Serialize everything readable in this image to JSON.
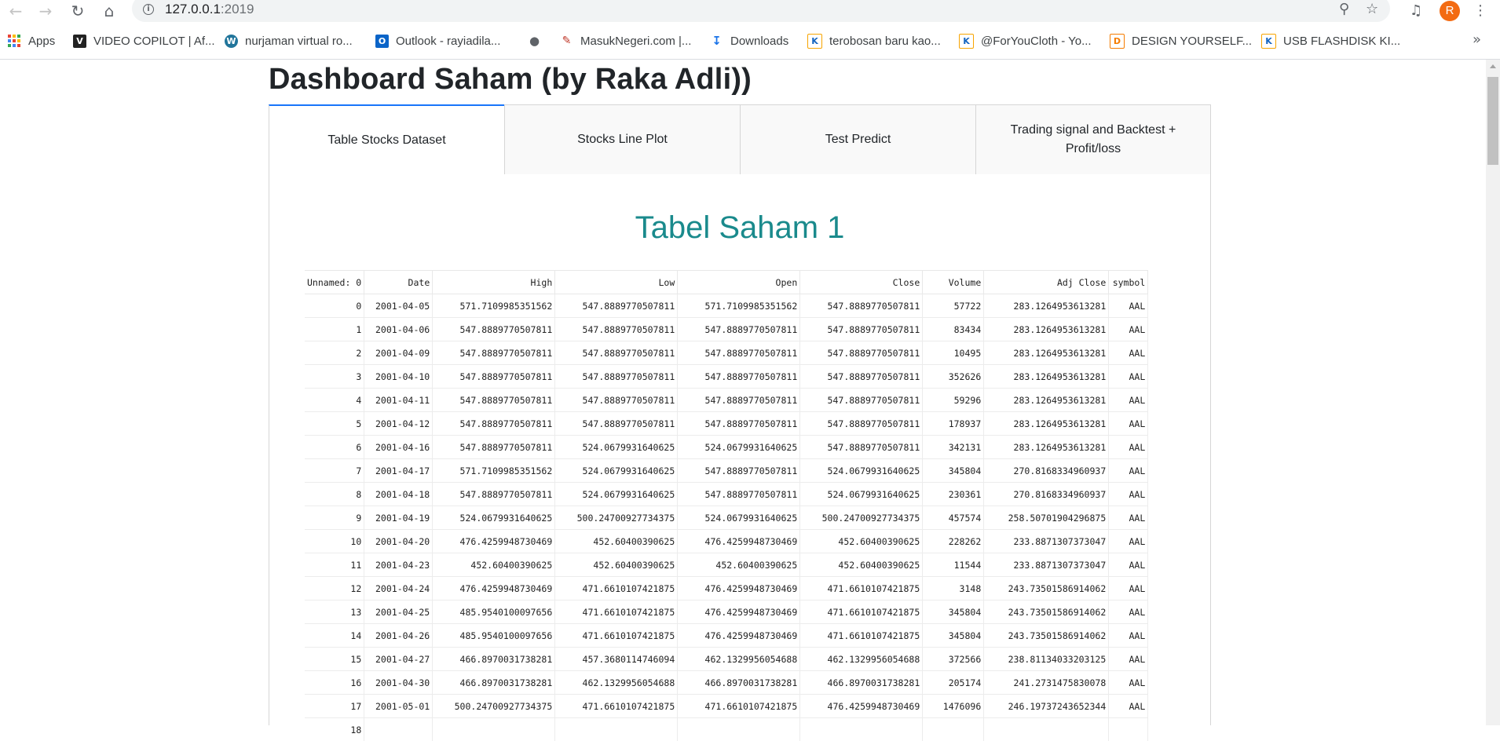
{
  "browser": {
    "url_host": "127.0.0.1",
    "url_port": ":2019",
    "avatar_letter": "R"
  },
  "bookmarks": [
    {
      "label": "Apps",
      "icon": "apps-grid-icon"
    },
    {
      "label": "VIDEO COPILOT | Af...",
      "icon": "videocopilot-icon"
    },
    {
      "label": "nurjaman virtual ro...",
      "icon": "wordpress-icon"
    },
    {
      "label": "Outlook - rayiadila...",
      "icon": "outlook-icon"
    },
    {
      "label": "",
      "icon": "globe-icon"
    },
    {
      "label": "MasukNegeri.com |...",
      "icon": "masuknegeri-icon"
    },
    {
      "label": "Downloads",
      "icon": "download-icon"
    },
    {
      "label": "terobosan baru kao...",
      "icon": "kaskus-icon"
    },
    {
      "label": "@ForYouCloth - Yo...",
      "icon": "kaskus-icon"
    },
    {
      "label": "DESIGN YOURSELF...",
      "icon": "design-icon"
    },
    {
      "label": "USB FLASHDISK KI...",
      "icon": "kaskus-icon"
    }
  ],
  "page": {
    "title": "Dashboard Saham (by Raka Adli))",
    "tabs": [
      {
        "label": "Table Stocks Dataset",
        "active": true
      },
      {
        "label": "Stocks Line Plot",
        "active": false
      },
      {
        "label": "Test Predict",
        "active": false
      },
      {
        "label": "Trading signal and Backtest + Profit/loss",
        "active": false
      }
    ],
    "section_title": "Tabel Saham 1"
  },
  "table": {
    "columns": [
      "Unnamed: 0",
      "Date",
      "High",
      "Low",
      "Open",
      "Close",
      "Volume",
      "Adj Close",
      "symbol"
    ],
    "rows": [
      [
        "0",
        "2001-04-05",
        "571.7109985351562",
        "547.8889770507811",
        "571.7109985351562",
        "547.8889770507811",
        "57722",
        "283.1264953613281",
        "AAL"
      ],
      [
        "1",
        "2001-04-06",
        "547.8889770507811",
        "547.8889770507811",
        "547.8889770507811",
        "547.8889770507811",
        "83434",
        "283.1264953613281",
        "AAL"
      ],
      [
        "2",
        "2001-04-09",
        "547.8889770507811",
        "547.8889770507811",
        "547.8889770507811",
        "547.8889770507811",
        "10495",
        "283.1264953613281",
        "AAL"
      ],
      [
        "3",
        "2001-04-10",
        "547.8889770507811",
        "547.8889770507811",
        "547.8889770507811",
        "547.8889770507811",
        "352626",
        "283.1264953613281",
        "AAL"
      ],
      [
        "4",
        "2001-04-11",
        "547.8889770507811",
        "547.8889770507811",
        "547.8889770507811",
        "547.8889770507811",
        "59296",
        "283.1264953613281",
        "AAL"
      ],
      [
        "5",
        "2001-04-12",
        "547.8889770507811",
        "547.8889770507811",
        "547.8889770507811",
        "547.8889770507811",
        "178937",
        "283.1264953613281",
        "AAL"
      ],
      [
        "6",
        "2001-04-16",
        "547.8889770507811",
        "524.0679931640625",
        "524.0679931640625",
        "547.8889770507811",
        "342131",
        "283.1264953613281",
        "AAL"
      ],
      [
        "7",
        "2001-04-17",
        "571.7109985351562",
        "524.0679931640625",
        "547.8889770507811",
        "524.0679931640625",
        "345804",
        "270.8168334960937",
        "AAL"
      ],
      [
        "8",
        "2001-04-18",
        "547.8889770507811",
        "524.0679931640625",
        "547.8889770507811",
        "524.0679931640625",
        "230361",
        "270.8168334960937",
        "AAL"
      ],
      [
        "9",
        "2001-04-19",
        "524.0679931640625",
        "500.24700927734375",
        "524.0679931640625",
        "500.24700927734375",
        "457574",
        "258.50701904296875",
        "AAL"
      ],
      [
        "10",
        "2001-04-20",
        "476.4259948730469",
        "452.60400390625",
        "476.4259948730469",
        "452.60400390625",
        "228262",
        "233.8871307373047",
        "AAL"
      ],
      [
        "11",
        "2001-04-23",
        "452.60400390625",
        "452.60400390625",
        "452.60400390625",
        "452.60400390625",
        "11544",
        "233.8871307373047",
        "AAL"
      ],
      [
        "12",
        "2001-04-24",
        "476.4259948730469",
        "471.6610107421875",
        "476.4259948730469",
        "471.6610107421875",
        "3148",
        "243.73501586914062",
        "AAL"
      ],
      [
        "13",
        "2001-04-25",
        "485.9540100097656",
        "471.6610107421875",
        "476.4259948730469",
        "471.6610107421875",
        "345804",
        "243.73501586914062",
        "AAL"
      ],
      [
        "14",
        "2001-04-26",
        "485.9540100097656",
        "471.6610107421875",
        "476.4259948730469",
        "471.6610107421875",
        "345804",
        "243.73501586914062",
        "AAL"
      ],
      [
        "15",
        "2001-04-27",
        "466.8970031738281",
        "457.3680114746094",
        "462.1329956054688",
        "462.1329956054688",
        "372566",
        "238.81134033203125",
        "AAL"
      ],
      [
        "16",
        "2001-04-30",
        "466.8970031738281",
        "462.1329956054688",
        "466.8970031738281",
        "466.8970031738281",
        "205174",
        "241.2731475830078",
        "AAL"
      ],
      [
        "17",
        "2001-05-01",
        "500.24700927734375",
        "471.6610107421875",
        "471.6610107421875",
        "476.4259948730469",
        "1476096",
        "246.19737243652344",
        "AAL"
      ],
      [
        "18",
        "",
        "",
        "",
        "",
        "",
        "",
        "",
        ""
      ]
    ]
  },
  "colors": {
    "tab_active_border": "#1975fa",
    "section_title": "#1a8a8c",
    "avatar": "#f36b12"
  }
}
